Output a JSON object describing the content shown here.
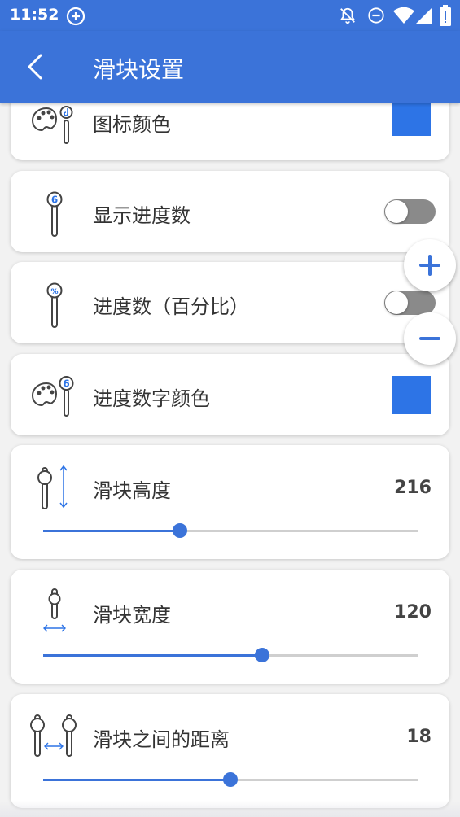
{
  "status_bar": {
    "time": "11:52",
    "icons": [
      "add-circle-icon",
      "bell-off-icon",
      "do-not-disturb-icon",
      "wifi-icon",
      "cell-signal-icon",
      "battery-alert-icon"
    ]
  },
  "app_bar": {
    "title": "滑块设置",
    "back_icon": "chevron-left-icon"
  },
  "colors": {
    "primary": "#3b73d9",
    "swatch": "#2d74e6",
    "toggle_off": "#8a8a8a",
    "background": "#f2f2f2"
  },
  "settings": {
    "icon_color": {
      "label": "图标颜色",
      "icon": "palette-slider-icon"
    },
    "show_progress": {
      "label": "显示进度数",
      "icon": "slider-number-icon",
      "enabled": false
    },
    "progress_percent": {
      "label": "进度数（百分比）",
      "icon": "slider-percent-icon",
      "enabled": false
    },
    "progress_text_color": {
      "label": "进度数字颜色",
      "icon": "palette-number-icon"
    },
    "slider_height": {
      "label": "滑块高度",
      "icon": "slider-height-icon",
      "value": "216",
      "fraction": 0.365
    },
    "slider_width": {
      "label": "滑块宽度",
      "icon": "slider-width-icon",
      "value": "120",
      "fraction": 0.585
    },
    "slider_spacing": {
      "label": "滑块之间的距离",
      "icon": "slider-spacing-icon",
      "value": "18",
      "fraction": 0.5
    }
  },
  "fab": {
    "zoom_in_icon": "plus-icon",
    "zoom_out_icon": "minus-icon"
  }
}
